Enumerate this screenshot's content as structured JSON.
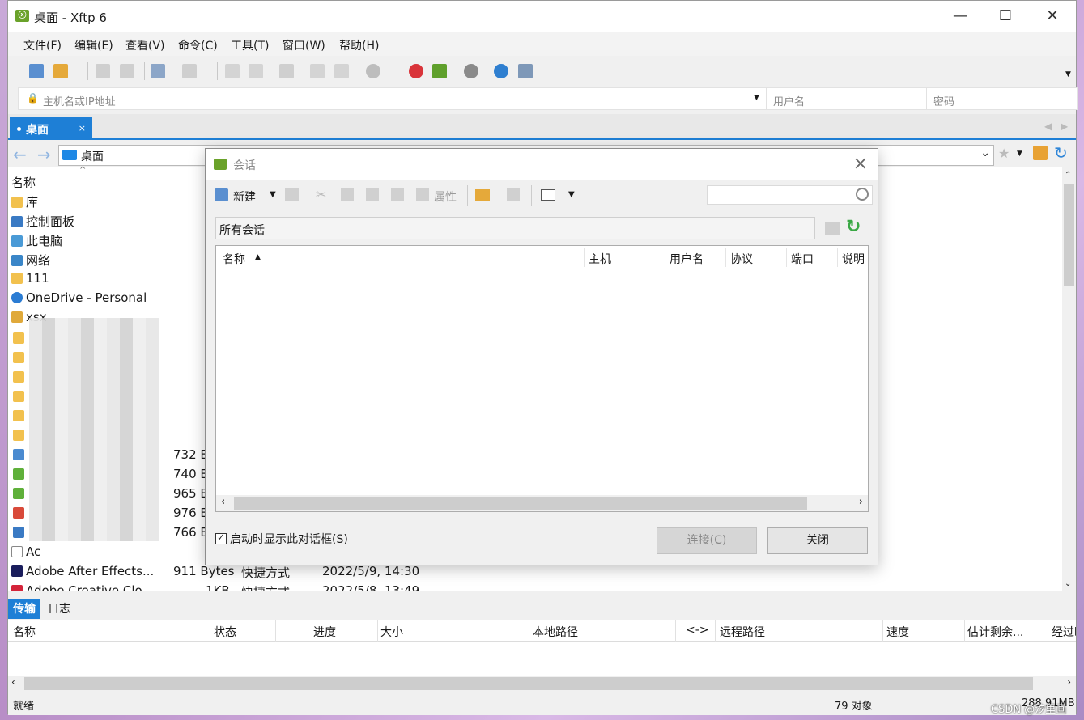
{
  "window": {
    "title": "桌面 - Xftp 6",
    "app_icon": "xftp-icon",
    "controls": [
      "—",
      "☐",
      "✕"
    ]
  },
  "menu": [
    "文件(F)",
    "编辑(E)",
    "查看(V)",
    "命令(C)",
    "工具(T)",
    "窗口(W)",
    "帮助(H)"
  ],
  "address": {
    "host_placeholder": "主机名或IP地址",
    "user_placeholder": "用户名",
    "password_placeholder": "密码"
  },
  "tabs": [
    {
      "label": "桌面",
      "close": "×"
    }
  ],
  "path": {
    "value": "桌面"
  },
  "files": {
    "header": "名称",
    "items": [
      {
        "name": "库",
        "icon": "library-icon",
        "color": "#f2c14e"
      },
      {
        "name": "控制面板",
        "icon": "control-panel-icon",
        "color": "#3a7ac4"
      },
      {
        "name": "此电脑",
        "icon": "computer-icon",
        "color": "#4a9ad6"
      },
      {
        "name": "网络",
        "icon": "network-icon",
        "color": "#3a86c8"
      },
      {
        "name": "111",
        "icon": "folder-icon",
        "color": "#f2c14e"
      },
      {
        "name": "OneDrive - Personal",
        "icon": "cloud-icon",
        "color": "#2b7cd3"
      },
      {
        "name": "xsx",
        "icon": "user-folder-icon",
        "color": "#e0a93a"
      }
    ],
    "sizes": [
      "732 B",
      "740 B",
      "965 B",
      "976 B",
      "766 B"
    ],
    "partial_row": "Ac",
    "bottom_rows": [
      {
        "name": "Adobe After Effects...",
        "size": "911 Bytes",
        "type": "快捷方式",
        "date": "2022/5/9, 14:30"
      },
      {
        "name": "Adobe Creative Clo...",
        "size": "1KB",
        "type": "快捷方式",
        "date": "2022/5/8, 13:49"
      }
    ]
  },
  "transfer": {
    "tabs": [
      "传输",
      "日志"
    ],
    "columns": [
      "名称",
      "状态",
      "进度",
      "大小",
      "本地路径",
      "<->",
      "远程路径",
      "速度",
      "估计剩余...",
      "经过时"
    ]
  },
  "status": {
    "left": "就绪",
    "objects": "79 对象",
    "size": "288.91MB"
  },
  "dialog": {
    "title": "会话",
    "new_label": "新建",
    "properties_label": "属性",
    "search_placeholder": "",
    "group": "所有会话",
    "columns": [
      "名称",
      "主机",
      "用户名",
      "协议",
      "端口",
      "说明"
    ],
    "checkbox_label": "启动时显示此对话框(S)",
    "connect_label": "连接(C)",
    "close_label": "关闭"
  },
  "watermark": "CSDN @汐里画"
}
